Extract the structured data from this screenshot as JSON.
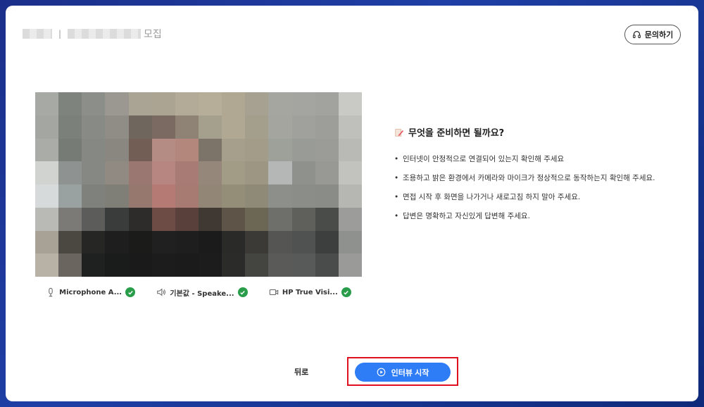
{
  "header": {
    "title": "모집",
    "separator": "|"
  },
  "inquiry_button": {
    "label": "문의하기",
    "icon": "headset-icon"
  },
  "video": {
    "description_icon": "camera-preview"
  },
  "devices": [
    {
      "label": "Microphone A...",
      "icon": "microphone-icon",
      "status": "ok"
    },
    {
      "label": "기본값 - Speake...",
      "icon": "speaker-icon",
      "status": "ok"
    },
    {
      "label": "HP True Visi...",
      "icon": "video-camera-icon",
      "status": "ok"
    }
  ],
  "preparation": {
    "title": "무엇을 준비하면 될까요?",
    "items": [
      "인터넷이 안정적으로 연결되어 있는지 확인해 주세요",
      "조용하고 밝은 환경에서 카메라와 마이크가 정상적으로 동작하는지 확인해 주세요.",
      "면접 시작 후 화면을 나가거나 새로고침 하지 말아 주세요.",
      "답변은 명확하고 자신있게 답변해 주세요."
    ]
  },
  "footer": {
    "back_label": "뒤로",
    "start_label": "인터뷰 시작"
  },
  "colors": {
    "accent": "#2f7df6",
    "success": "#2a9d4a",
    "highlight": "#e0101e",
    "background": "#1f3fa6"
  }
}
